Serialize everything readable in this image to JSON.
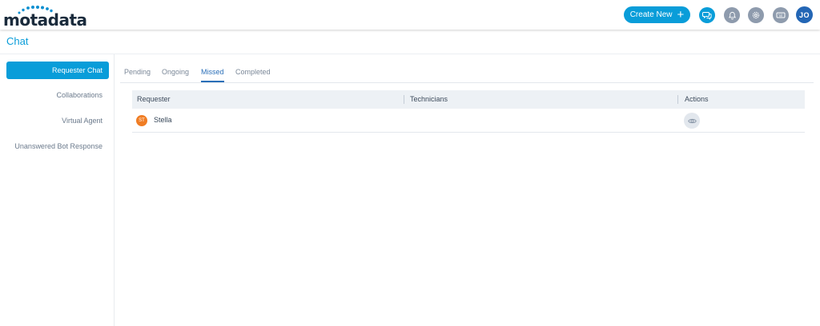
{
  "header": {
    "logo_text": "motadata",
    "create_new_label": "Create New",
    "user_initials": "JO",
    "colors": {
      "accent": "#099dd9",
      "icon_gray": "#8e9bad",
      "avatar": "#2366b5"
    },
    "icons": [
      "chat-icon",
      "bell-icon",
      "gear-icon",
      "keyboard-icon"
    ]
  },
  "page": {
    "title": "Chat"
  },
  "sidebar": {
    "items": [
      {
        "label": "Requester Chat",
        "active": true
      },
      {
        "label": "Collaborations",
        "active": false
      },
      {
        "label": "Virtual Agent",
        "active": false
      },
      {
        "label": "Unanswered Bot Response",
        "active": false
      }
    ]
  },
  "tabs": [
    {
      "label": "Pending",
      "active": false
    },
    {
      "label": "Ongoing",
      "active": false
    },
    {
      "label": "Missed",
      "active": true
    },
    {
      "label": "Completed",
      "active": false
    }
  ],
  "table": {
    "columns": [
      "Requester",
      "Technicians",
      "Actions"
    ],
    "rows": [
      {
        "initials": "ST",
        "requester": "Stella",
        "technicians": "",
        "action_icon": "eye-icon"
      }
    ]
  }
}
